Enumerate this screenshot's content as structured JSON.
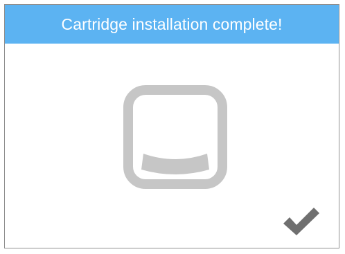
{
  "dialog": {
    "title": "Cartridge installation complete!"
  },
  "icons": {
    "main": "cartridge-icon",
    "confirm": "checkmark-icon"
  },
  "colors": {
    "header_background": "#5cb3f2",
    "header_text": "#ffffff",
    "icon_gray": "#c6c6c6",
    "check_gray": "#6f6f6f",
    "border": "#8f8f8f"
  }
}
